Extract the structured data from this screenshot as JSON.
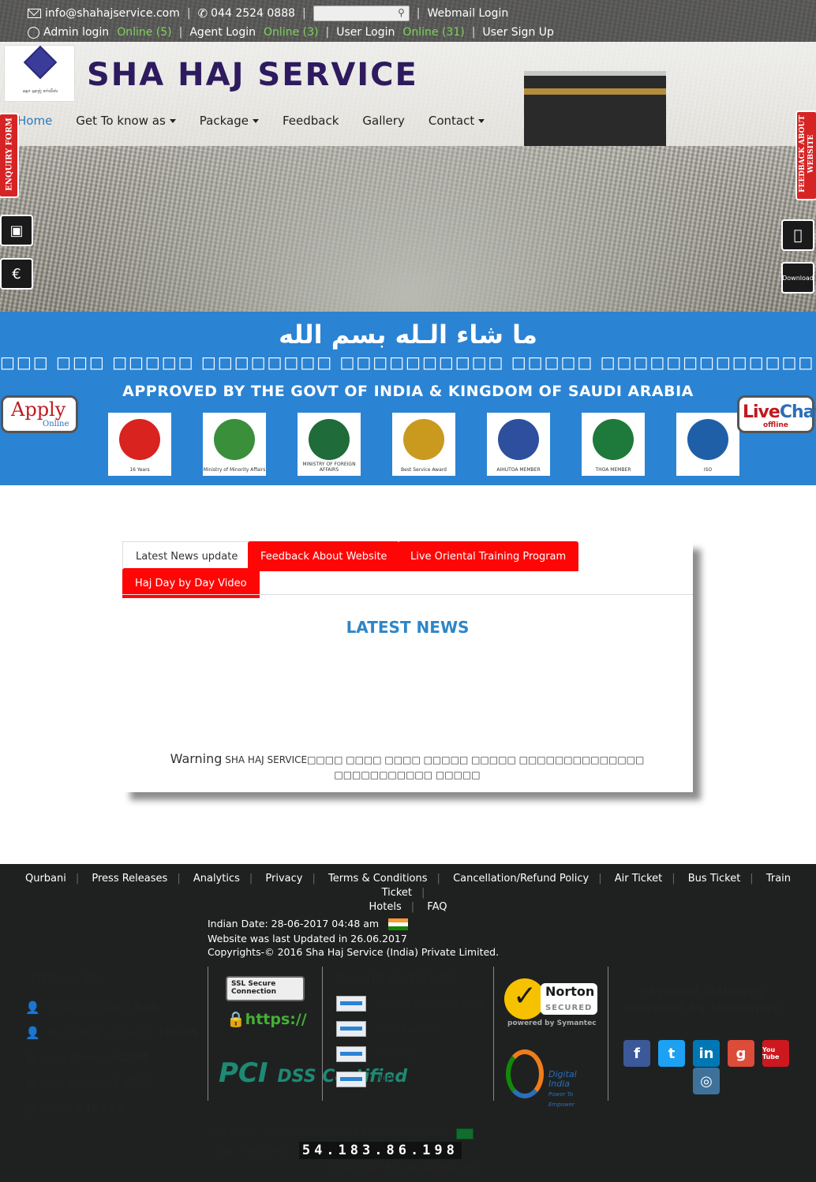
{
  "topbar": {
    "email": "info@shahajservice.com",
    "phone": "044 2524 0888",
    "search_placeholder": "",
    "webmail": "Webmail Login",
    "admin_login": "Admin login",
    "admin_online": "Online (5)",
    "agent_login": "Agent Login",
    "agent_online": "Online (3)",
    "user_login": "User Login",
    "user_online": "Online (31)",
    "user_signup": "User Sign Up"
  },
  "header": {
    "logo_subtext": "ஷா ஹஜ் சர்வீஸ்",
    "brand": "SHA HAJ SERVICE"
  },
  "nav": {
    "home": "Home",
    "get_to_know": "Get To know as",
    "package": "Package",
    "feedback": "Feedback",
    "gallery": "Gallery",
    "contact": "Contact"
  },
  "side_tabs": {
    "enquiry": "ENQUIRY FORM",
    "feedback": "FEEDBACK ABOUT WEBSITE",
    "download": "Download"
  },
  "band": {
    "arabic": "ما  شاء  الـله       بسم الله",
    "tamil": "□□□ □□□ □□□□□ □□□□□□□□ □□□□□□□□□□ □□□□□ □□□□□□□□□□□□□□",
    "approved": "APPROVED BY THE GOVT OF INDIA & KINGDOM OF SAUDI ARABIA",
    "apply_1": "Apply",
    "apply_2": "Online",
    "livechat_1": "Live",
    "livechat_2": "Chat",
    "livechat_3": "offline",
    "badges": [
      {
        "label": "16 Years",
        "color": "#d8231f"
      },
      {
        "label": "Ministry of Minority Affairs",
        "color": "#3a8f3a"
      },
      {
        "label": "MINISTRY OF FOREIGN AFFAIRS",
        "color": "#1f6b3a"
      },
      {
        "label": "Best Service Award",
        "color": "#c99a1e"
      },
      {
        "label": "AIHUTOA MEMBER",
        "color": "#2d4f9e"
      },
      {
        "label": "THOA MEMBER",
        "color": "#1e7a3a"
      },
      {
        "label": "ISO",
        "color": "#1f5fa8"
      }
    ]
  },
  "tabs": {
    "t1": "Latest News update",
    "t2": "Feedback About Website",
    "t3": "Live Oriental Training Program",
    "t4": "Haj Day by Day Video",
    "news_title": "LATEST NEWS",
    "warn_1": "Warning",
    "warn_2": "SHA HAJ SERVICE",
    "warn_3": "□□□□ □□□□ □□□□ □□□□□ □□□□□ □□□□□□□□□□□□□□",
    "warn_4": "□□□□□□□□□□□ □□□□□"
  },
  "footer_links": [
    "Qurbani",
    "Press Releases",
    "Analytics",
    "Privacy",
    "Terms & Conditions",
    "Cancellation/Refund Policy",
    "Air Ticket",
    "Bus Ticket",
    "Train Ticket"
  ],
  "footer_links_2": [
    "Hotels",
    "FAQ"
  ],
  "footer_info": {
    "indian_date": "Indian Date: 28-06-2017 04:48 am",
    "updated": "Website was last Updated in 26.06.2017",
    "copyright": "Copyrights-© 2016 Sha Haj Service (India) Private Limited."
  },
  "total_view": {
    "title": "TOTAL VIEW",
    "today_label": "Today's Count:",
    "today": "619",
    "yesterday_label": "Yesterday's Count:",
    "yesterday": "14644",
    "week_label": "Last Week:",
    "week": "34244",
    "month_label": "Last Month:",
    "month": "69566",
    "total_label": "Total:",
    "total": "336445"
  },
  "security": {
    "ssl": "SSL Secure Connection",
    "https": "https://",
    "pci": "PCI",
    "dss": "DSS Certified"
  },
  "payments": {
    "title": "ONLINE PAYMENTS",
    "items": [
      "Credit & Debit Cards",
      "Net Banking",
      "Wallets",
      "UPI"
    ]
  },
  "norton": {
    "name": "Norton",
    "secured": "SECURED",
    "powered": "powered by Symantec"
  },
  "digital_india": {
    "name": "Digital India",
    "tag": "Power To Empower"
  },
  "gateway": {
    "line1": "Payment Gateway",
    "line2": "Powered by Instamojo"
  },
  "social": [
    {
      "label": "f",
      "color": "#3b5998"
    },
    {
      "label": "t",
      "color": "#1da1f2"
    },
    {
      "label": "in",
      "color": "#0077b5"
    },
    {
      "label": "g",
      "color": "#dd4b39"
    },
    {
      "label": "You Tube",
      "color": "#cc181e"
    },
    {
      "label": "◎",
      "color": "#3f729b"
    }
  ],
  "bottom": {
    "hijri": "Hijri Date : Ithnin, 2 Shawwal 1438 AH   02:18 am",
    "ip_label": "Your IP Address :",
    "ip": "54.183.86.198",
    "developer": "Developed By Anusuyaw3.com"
  }
}
